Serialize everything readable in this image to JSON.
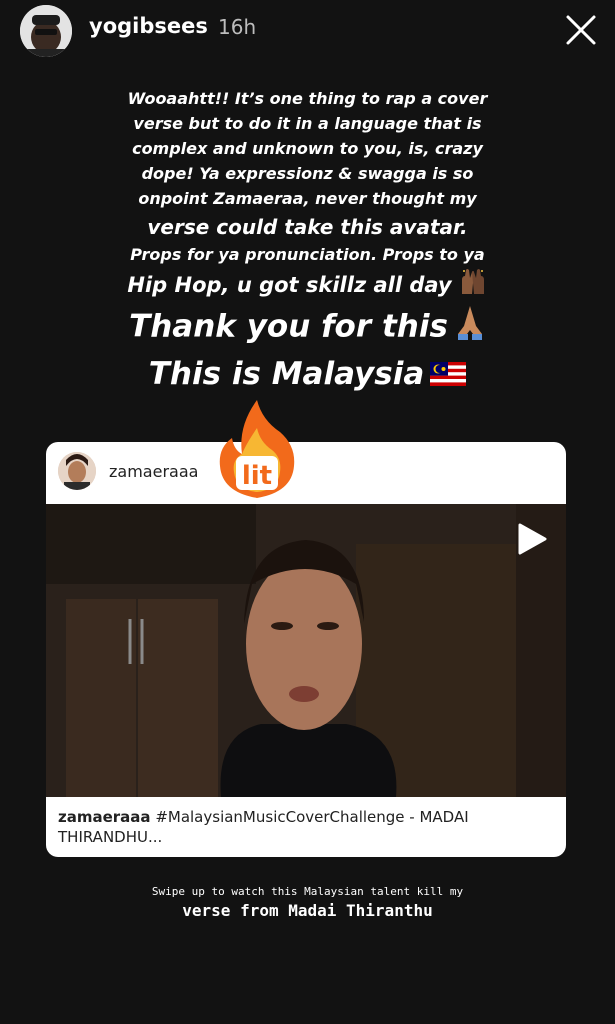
{
  "header": {
    "username": "yogibsees",
    "time": "16h"
  },
  "caption": {
    "lines": [
      "Wooaahtt!! It’s one thing to rap a cover",
      "verse but to do it in a language that is",
      "complex and unknown to you, is, crazy",
      "dope! Ya expressionz & swagga is so",
      "onpoint Zamaeraa, never thought my",
      "verse could take this avatar.",
      "Props for ya pronunciation. Props to ya",
      "Hip Hop, u got skillz all day",
      "Thank you for this",
      "This is Malaysia"
    ],
    "emojis": {
      "raised_hands": "raised-hands-icon",
      "praying_hands": "praying-hands-icon",
      "flag": "malaysia-flag-icon"
    }
  },
  "sticker": {
    "text": "lit"
  },
  "post": {
    "username": "zamaeraaa",
    "caption_user": "zamaeraaa",
    "caption_text": " #MalaysianMusicCoverChallenge - MADAI THIRANDHU..."
  },
  "footer": {
    "line1": "Swipe up to watch this Malaysian talent kill my",
    "line2": "verse from Madai Thiranthu"
  },
  "colors": {
    "background": "#121212",
    "sticker_orange": "#f26a1b",
    "sticker_yellow": "#f7b733",
    "card": "#ffffff"
  }
}
